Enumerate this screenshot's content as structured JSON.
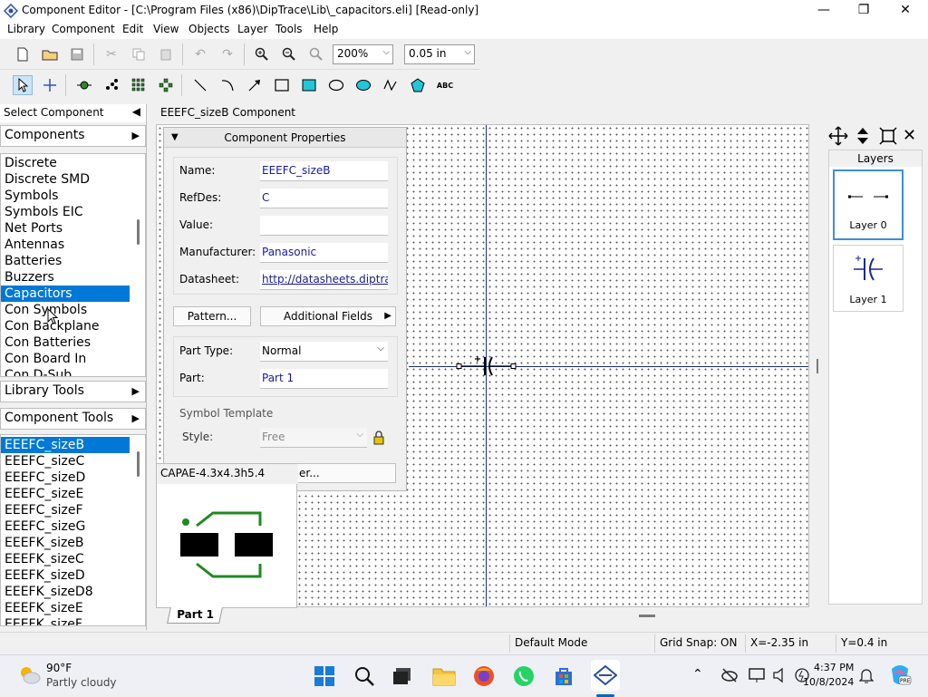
{
  "window": {
    "title": "Component Editor - [C:\\Program Files (x86)\\DipTrace\\Lib\\_capacitors.eli] [Read-only]",
    "minimize": "—",
    "maximize": "❐",
    "close": "✕"
  },
  "menu": [
    "Library",
    "Component",
    "Edit",
    "View",
    "Objects",
    "Layer",
    "Tools",
    "Help"
  ],
  "toolbar": {
    "zoom_value": "200%",
    "grid_value": "0.05 in",
    "text_tool": "ABC"
  },
  "left_pane": {
    "header": "Select Component",
    "components_label": "Components",
    "library_tools_label": "Library Tools",
    "component_tools_label": "Component Tools",
    "libraries": [
      "Discrete",
      "Discrete SMD",
      "Symbols",
      "Symbols EIC",
      "Net Ports",
      "Antennas",
      "Batteries",
      "Buzzers",
      "Capacitors",
      "Con Symbols",
      "Con Backplane",
      "Con Batteries",
      "Con Board In",
      "Con D-Sub"
    ],
    "selected_library": "Capacitors",
    "components": [
      "EEEFC_sizeB",
      "EEEFC_sizeC",
      "EEEFC_sizeD",
      "EEEFC_sizeE",
      "EEEFC_sizeF",
      "EEEFC_sizeG",
      "EEEFK_sizeB",
      "EEEFK_sizeC",
      "EEEFK_sizeD",
      "EEEFK_sizeD8",
      "EEEFK_sizeE",
      "EEEFK_sizeF"
    ],
    "selected_component": "EEEFC_sizeB"
  },
  "canvas": {
    "header": "EEEFC_sizeB Component"
  },
  "component_properties": {
    "title": "Component Properties",
    "name_label": "Name:",
    "name_value": "EEEFC_sizeB",
    "refdes_label": "RefDes:",
    "refdes_value": "C",
    "value_label": "Value:",
    "value_value": "",
    "manufacturer_label": "Manufacturer:",
    "manufacturer_value": "Panasonic",
    "datasheet_label": "Datasheet:",
    "datasheet_value": "http://datasheets.diptrac",
    "pattern_button": "Pattern...",
    "additional_fields_button": "Additional Fields",
    "part_type_label": "Part Type:",
    "part_type_value": "Normal",
    "part_label": "Part:",
    "part_value": "Part 1",
    "symbol_template_label": "Symbol Template",
    "style_label": "Style:",
    "style_value": "Free",
    "hidden_button_tail": "er..."
  },
  "pattern_popup": {
    "title": "CAPAE-4.3x4.3h5.4"
  },
  "layers": {
    "title": "Layers",
    "items": [
      "Layer 0",
      "Layer 1"
    ]
  },
  "tabs": [
    "Part 1"
  ],
  "status": {
    "mode": "Default Mode",
    "grid_snap": "Grid Snap: ON",
    "x": "X=-2.35 in",
    "y": "Y=0.4 in"
  },
  "taskbar": {
    "temperature": "90°F",
    "weather": "Partly cloudy",
    "time": "4:37 PM",
    "date": "10/8/2024"
  }
}
